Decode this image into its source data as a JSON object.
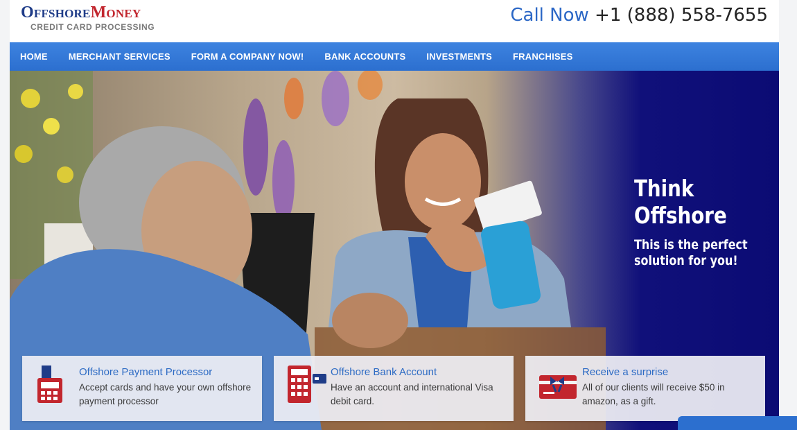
{
  "header": {
    "logo_part1": "Offshore",
    "logo_part2": "Money",
    "logo_tagline": "CREDIT CARD PROCESSING",
    "call_label": "Call Now",
    "phone": "+1 (888) 558-7655"
  },
  "nav": {
    "items": [
      {
        "label": "HOME"
      },
      {
        "label": "MERCHANT SERVICES"
      },
      {
        "label": "FORM A COMPANY NOW!"
      },
      {
        "label": "BANK ACCOUNTS"
      },
      {
        "label": "INVESTMENTS"
      },
      {
        "label": "FRANCHISES"
      }
    ]
  },
  "hero": {
    "title_line1": "Think",
    "title_line2": "Offshore",
    "subtitle_line1": "This is the perfect",
    "subtitle_line2": "solution for you!"
  },
  "cards": [
    {
      "title": "Offshore Payment Processor",
      "desc": "Accept cards and have your own offshore payment processor",
      "icon": "payment-terminal-icon"
    },
    {
      "title": "Offshore Bank Account",
      "desc": "Have an account and international Visa debit card.",
      "icon": "calculator-card-icon"
    },
    {
      "title": "Receive a surprise",
      "desc": "All of our clients will receive $50 in amazon, as a gift.",
      "icon": "gift-card-icon"
    }
  ],
  "colors": {
    "brand_blue": "#2c6fcf",
    "brand_red": "#c2262e",
    "hero_navy": "#0b0b74",
    "link_blue": "#2d6bc4"
  }
}
